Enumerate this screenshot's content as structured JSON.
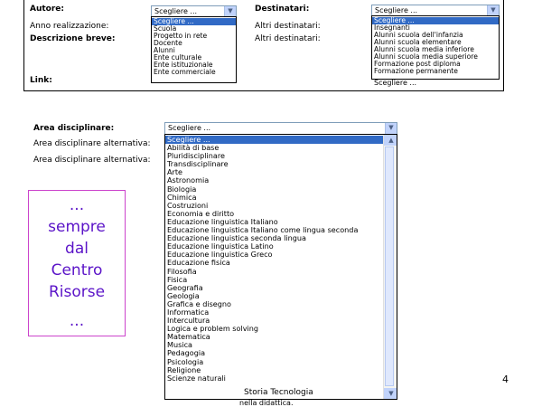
{
  "top_form": {
    "autore_label": "Autore:",
    "anno_label": "Anno realizzazione:",
    "descrizione_label": "Descrizione breve:",
    "link_label": "Link:",
    "destinatari_label": "Destinatari:",
    "altri_dest_label": "Altri destinatari:",
    "autore_select_value": "Scegliere ...",
    "autore_options": [
      "Scegliere ...",
      "Scuola",
      "Progetto in rete",
      "Docente",
      "Alunni",
      "Ente culturale",
      "Ente istituzionale",
      "Ente commerciale"
    ],
    "destinatari_select_value": "Scegliere ...",
    "destinatari_options": [
      "Scegliere ...",
      "Insegnanti",
      "Alunni scuola dell'infanzia",
      "Alunni scuola elementare",
      "Alunni scuola media inferiore",
      "Alunni scuola media superiore",
      "Formazione post diploma",
      "Formazione permanente"
    ],
    "destinatari_below": "Scegliere ..."
  },
  "area_form": {
    "area_label": "Area disciplinare:",
    "alt1_label": "Area disciplinare alternativa:",
    "alt2_label": "Area disciplinare alternativa:",
    "select_value": "Scegliere ...",
    "options": [
      "Scegliere ...",
      "Abilità di base",
      "Pluridisciplinare",
      "Transdisciplinare",
      "Arte",
      "Astronomia",
      "Biologia",
      "Chimica",
      "Costruzioni",
      "Economia e diritto",
      "Educazione linguistica Italiano",
      "Educazione linguistica Italiano come lingua seconda",
      "Educazione linguistica seconda lingua",
      "Educazione linguistica Latino",
      "Educazione linguistica Greco",
      "Educazione fisica",
      "Filosofia",
      "Fisica",
      "Geografia",
      "Geologia",
      "Grafica e disegno",
      "Informatica",
      "Intercultura",
      "Logica e problem solving",
      "Matematica",
      "Musica",
      "Pedagogia",
      "Psicologia",
      "Religione",
      "Scienze naturali"
    ],
    "bottom_overlap_text": "Storia  Tecnologia",
    "bottom_under_text": "nella didattica."
  },
  "callout": {
    "lines": [
      "...",
      "sempre",
      "dal",
      "Centro",
      "Risorse",
      "..."
    ],
    "color": "#5b14c8",
    "border_color": "#cc44cc"
  },
  "page_number": "4",
  "icons": {
    "dropdown": "chevron-down-icon",
    "scroll_up": "scroll-up-arrow-icon",
    "scroll_down": "scroll-down-arrow-icon"
  }
}
